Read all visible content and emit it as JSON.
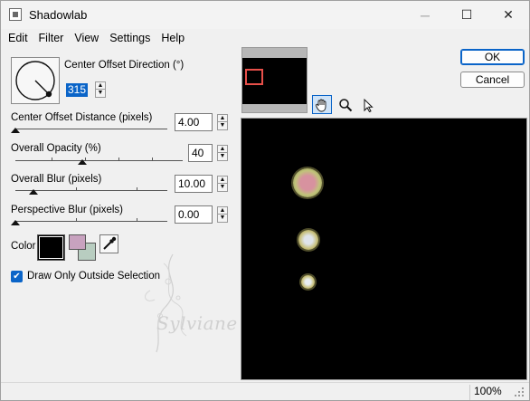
{
  "window": {
    "title": "Shadowlab",
    "app_icon": "shadowlab-app-icon"
  },
  "window_controls": {
    "minimize": "─",
    "maximize": "☐",
    "close": "✕"
  },
  "menu": [
    "Edit",
    "Filter",
    "View",
    "Settings",
    "Help"
  ],
  "settings": {
    "direction_label": "Center Offset Direction (°)",
    "direction_value": "315",
    "distance_label": "Center Offset Distance (pixels)",
    "distance_value": "4.00",
    "opacity_label": "Overall Opacity (%)",
    "opacity_value": "40",
    "blur_label": "Overall Blur (pixels)",
    "blur_value": "10.00",
    "perspective_label": "Perspective Blur (pixels)",
    "perspective_value": "0.00",
    "color_label": "Color",
    "draw_outside_label": "Draw Only Outside Selection",
    "draw_outside_checked": true
  },
  "slider_levels": {
    "distance_fraction": 0.0,
    "opacity_fraction": 0.4,
    "blur_fraction": 0.12,
    "perspective_fraction": 0.0
  },
  "colors": {
    "shadow": "#000000",
    "foreground_swatch": "#c8a2bf",
    "background_swatch": "#b8cdc0",
    "accent": "#0a64c8"
  },
  "buttons": {
    "ok": "OK",
    "cancel": "Cancel"
  },
  "tools": [
    "hand-pan-icon",
    "zoom-magnifier-icon",
    "arrow-pointer-icon"
  ],
  "watermark": {
    "text": "Sylviane"
  },
  "status": {
    "zoom": "100%"
  }
}
